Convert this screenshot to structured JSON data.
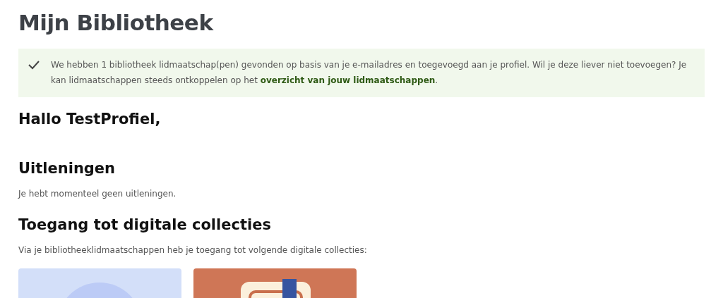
{
  "page_title": "Mijn Bibliotheek",
  "notice": {
    "text": "We hebben 1 bibliotheek lidmaatschap(pen) gevonden op basis van je e-mailadres en toegevoegd aan je profiel. Wil je deze liever niet toevoegen? Je kan lidmaatschappen steeds ontkoppelen op het ",
    "link": "overzicht van jouw lidmaatschappen",
    "text_after": "."
  },
  "greeting": "Hallo TestProfiel,",
  "loans": {
    "heading": "Uitleningen",
    "text": "Je hebt momenteel geen uitleningen."
  },
  "collections": {
    "heading": "Toegang tot digitale collecties",
    "text": "Via je bibliotheeklidmaatschappen heb je toegang tot volgende digitale collecties:",
    "tiles": [
      {
        "kind": "circle",
        "color": "#d3dff9"
      },
      {
        "kind": "book",
        "color": "#cf7656"
      }
    ]
  }
}
